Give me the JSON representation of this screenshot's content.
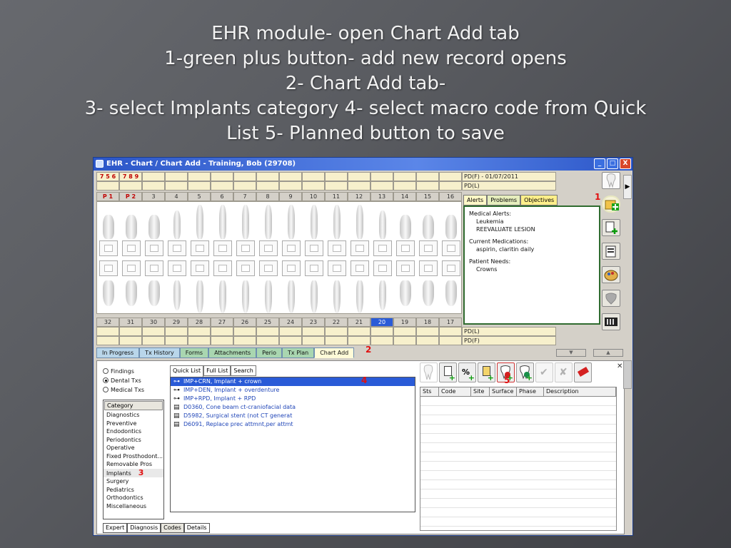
{
  "slide": {
    "lines": [
      "EHR module- open Chart Add tab",
      "1-green plus button- add new record opens",
      "2- Chart Add tab-",
      "3- select Implants category 4- select macro code from Quick",
      "List 5- Planned button to save"
    ]
  },
  "window": {
    "title": "EHR - Chart / Chart Add - Training, Bob (29708)",
    "buttons": [
      "_",
      "□",
      "X"
    ]
  },
  "chart": {
    "top_marks": [
      "7",
      "5",
      "6",
      "7",
      "8",
      "9",
      "",
      "",
      "",
      "",
      "",
      "",
      "",
      "",
      "",
      ""
    ],
    "upper_numbers": [
      "P 1",
      "P 2",
      "3",
      "4",
      "5",
      "6",
      "7",
      "8",
      "9",
      "10",
      "11",
      "12",
      "13",
      "14",
      "15",
      "16"
    ],
    "lower_numbers": [
      "32",
      "31",
      "30",
      "29",
      "28",
      "27",
      "26",
      "25",
      "24",
      "23",
      "22",
      "21",
      "20",
      "19",
      "18",
      "17"
    ],
    "selected_lower": "20",
    "pd_top": [
      "PD(F) - 01/07/2011",
      "PD(L)"
    ],
    "pd_bottom": [
      "PD(L)",
      "PD(F)"
    ]
  },
  "alerts": {
    "tabs": [
      "Alerts",
      "Problems",
      "Objectives"
    ],
    "medical_alerts_label": "Medical Alerts:",
    "medical_alerts": [
      "Leukemia",
      "REEVALUATE LESION"
    ],
    "medications_label": "Current Medications:",
    "medications": [
      "aspirin, claritin daily"
    ],
    "needs_label": "Patient Needs:",
    "needs": [
      "Crowns"
    ]
  },
  "module_tabs": [
    "In Progress",
    "Tx History",
    "Forms",
    "Attachments",
    "Perio",
    "Tx Plan",
    "Chart Add"
  ],
  "module_active": "Chart Add",
  "callouts": {
    "c1": "1",
    "c2": "2",
    "c3": "3",
    "c4": "4",
    "c5": "5"
  },
  "filter": {
    "options": [
      "Findings",
      "Dental Txs",
      "Medical Txs"
    ],
    "selected": "Dental Txs"
  },
  "category": {
    "header": "Category",
    "items": [
      "Diagnostics",
      "Preventive",
      "Endodontics",
      "Periodontics",
      "Operative",
      "Fixed Prosthodont...",
      "Removable Pros",
      "Implants",
      "Surgery",
      "Pediatrics",
      "Orthodontics",
      "Miscellaneous"
    ],
    "selected": "Implants"
  },
  "quicklist": {
    "tabs": [
      "Quick List",
      "Full List",
      "Search"
    ],
    "items": [
      {
        "text": "IMP+CRN, Implant + crown",
        "kind": "macro"
      },
      {
        "text": "IMP+DEN, Implant + overdenture",
        "kind": "macro"
      },
      {
        "text": "IMP+RPD, Implant + RPD",
        "kind": "macro"
      },
      {
        "text": "D0360, Cone beam ct-craniofacial data",
        "kind": "code"
      },
      {
        "text": "D5982, Surgical stent (not CT generat",
        "kind": "code"
      },
      {
        "text": "D6091, Replace prec attmnt,per attmt",
        "kind": "code"
      }
    ],
    "selected_index": 0
  },
  "grid": {
    "columns": [
      "Sts",
      "Code",
      "Site",
      "Surface",
      "Phase",
      "Description"
    ]
  },
  "bottom_tabs": [
    "Expert",
    "Diagnosis",
    "Codes",
    "Details"
  ],
  "bottom_active": "Codes",
  "colors": {
    "accent": "#2a5bd7",
    "callout": "#e01010",
    "alerts_border": "#2f6b2f"
  }
}
